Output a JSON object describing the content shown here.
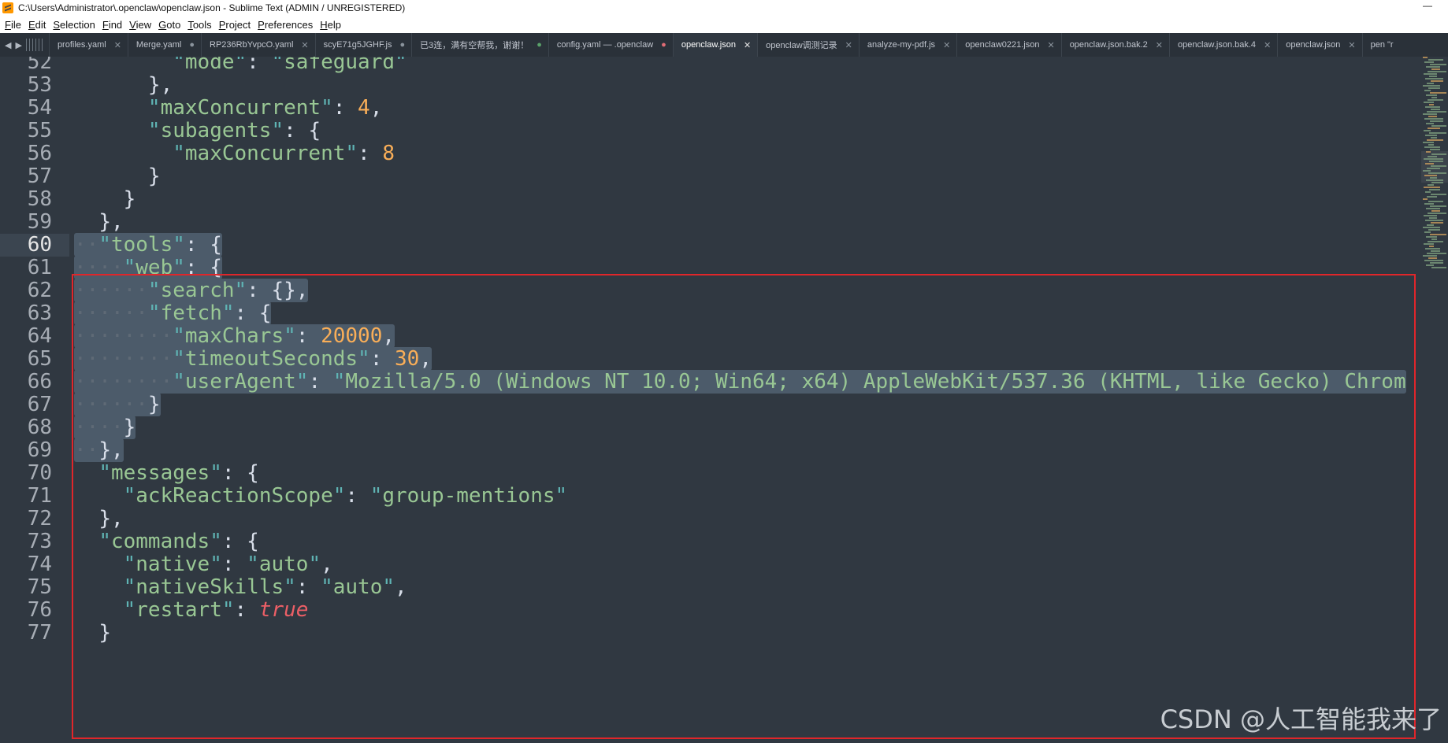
{
  "window": {
    "title": "C:\\Users\\Administrator\\.openclaw\\openclaw.json - Sublime Text (ADMIN / UNREGISTERED)",
    "minimize_glyph": "—"
  },
  "menu": {
    "items": [
      "File",
      "Edit",
      "Selection",
      "Find",
      "View",
      "Goto",
      "Tools",
      "Project",
      "Preferences",
      "Help"
    ]
  },
  "tabs": [
    {
      "label": "profiles.yaml",
      "state": "close"
    },
    {
      "label": "Merge.yaml",
      "state": "dot"
    },
    {
      "label": "RP236RbYvpcO.yaml",
      "state": "close"
    },
    {
      "label": "scyE71g5JGHF.js",
      "state": "dot"
    },
    {
      "label": "已3连，满有空帮我，谢谢！",
      "state": "modified"
    },
    {
      "label": "config.yaml — .openclaw",
      "state": "red"
    },
    {
      "label": "openclaw.json",
      "state": "close",
      "active": true
    },
    {
      "label": "openclaw调测记录",
      "state": "close"
    },
    {
      "label": "analyze-my-pdf.js",
      "state": "close"
    },
    {
      "label": "openclaw0221.json",
      "state": "close"
    },
    {
      "label": "openclaw.json.bak.2",
      "state": "close"
    },
    {
      "label": "openclaw.json.bak.4",
      "state": "close"
    },
    {
      "label": "openclaw.json",
      "state": "close"
    },
    {
      "label": "pen \"r",
      "state": "none"
    }
  ],
  "editor": {
    "current_line": "60",
    "lines": [
      {
        "n": "52",
        "text": "        \"mode\": \"safeguard\""
      },
      {
        "n": "53",
        "text": "      },"
      },
      {
        "n": "54",
        "text": "      \"maxConcurrent\": 4,"
      },
      {
        "n": "55",
        "text": "      \"subagents\": {"
      },
      {
        "n": "56",
        "text": "        \"maxConcurrent\": 8"
      },
      {
        "n": "57",
        "text": "      }"
      },
      {
        "n": "58",
        "text": "    }"
      },
      {
        "n": "59",
        "text": "  },"
      },
      {
        "n": "60",
        "text": "  \"tools\": {"
      },
      {
        "n": "61",
        "text": "    \"web\": {"
      },
      {
        "n": "62",
        "text": "      \"search\": {},"
      },
      {
        "n": "63",
        "text": "      \"fetch\": {"
      },
      {
        "n": "64",
        "text": "        \"maxChars\": 20000,"
      },
      {
        "n": "65",
        "text": "        \"timeoutSeconds\": 30,"
      },
      {
        "n": "66",
        "text": "        \"userAgent\": \"Mozilla/5.0 (Windows NT 10.0; Win64; x64) AppleWebKit/537.36 (KHTML, like Gecko) Chrom"
      },
      {
        "n": "67",
        "text": "      }"
      },
      {
        "n": "68",
        "text": "    }"
      },
      {
        "n": "69",
        "text": "  },"
      },
      {
        "n": "70",
        "text": "  \"messages\": {"
      },
      {
        "n": "71",
        "text": "    \"ackReactionScope\": \"group-mentions\""
      },
      {
        "n": "72",
        "text": "  },"
      },
      {
        "n": "73",
        "text": "  \"commands\": {"
      },
      {
        "n": "74",
        "text": "    \"native\": \"auto\","
      },
      {
        "n": "75",
        "text": "    \"nativeSkills\": \"auto\","
      },
      {
        "n": "76",
        "text": "    \"restart\": true"
      },
      {
        "n": "77",
        "text": "  }"
      }
    ]
  },
  "watermark": "CSDN @人工智能我来了",
  "colors": {
    "editor_bg": "#303841",
    "tabbar_bg": "#2a3139",
    "key": "#99c794",
    "number": "#f9ae58",
    "boolean": "#ec5f66",
    "selection": "#4c5b6a",
    "highlight_box": "#e0262a"
  }
}
